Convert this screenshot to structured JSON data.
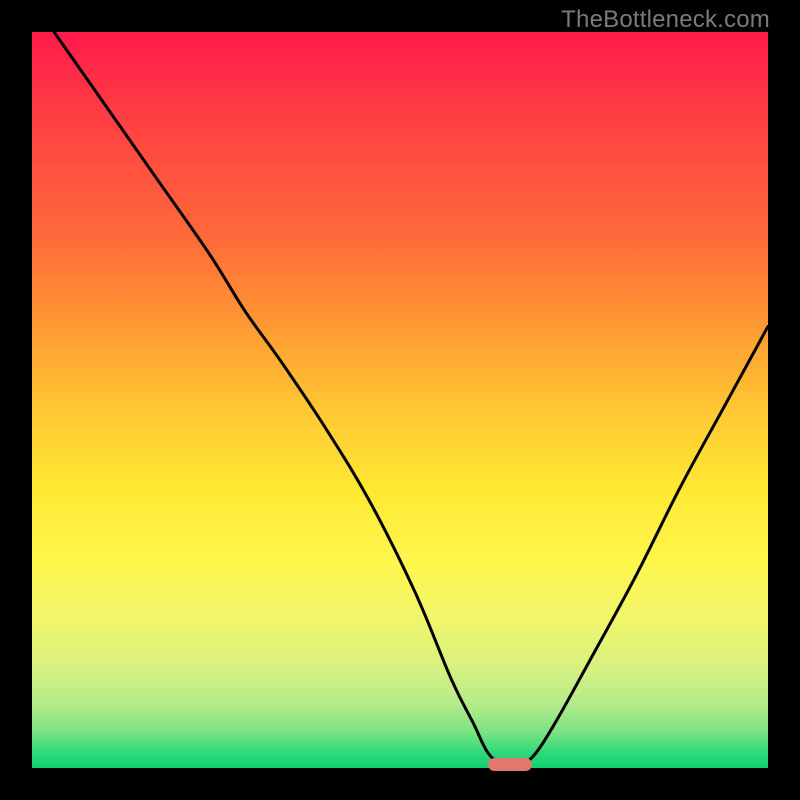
{
  "watermark": "TheBottleneck.com",
  "colors": {
    "page_bg": "#000000",
    "curve_stroke": "#000000",
    "marker_fill": "#e2786d",
    "watermark_fg": "#7a7a7a"
  },
  "chart_data": {
    "type": "line",
    "title": "",
    "xlabel": "",
    "ylabel": "",
    "xlim": [
      0,
      100
    ],
    "ylim": [
      0,
      100
    ],
    "grid": false,
    "legend": false,
    "note": "No axis ticks or labels rendered; values are read as percentages of the plot area. y=0 is the bottom (green), y=100 is the top (red). Curve descends from top-left, flattens near bottom around x≈62–67, then rises toward the right edge.",
    "series": [
      {
        "name": "bottleneck-curve",
        "x": [
          3,
          10,
          17,
          24,
          29,
          34,
          40,
          46,
          52,
          57,
          60,
          62,
          64,
          66,
          68,
          71,
          76,
          82,
          88,
          94,
          100
        ],
        "y": [
          100,
          90,
          80,
          70,
          62,
          55,
          46,
          36,
          24,
          12,
          6,
          2,
          0.5,
          0.5,
          1.5,
          6,
          15,
          26,
          38,
          49,
          60
        ]
      }
    ],
    "marker": {
      "name": "optimal-range",
      "x_start": 62,
      "x_end": 68,
      "y": 0.5
    },
    "background_gradient": [
      {
        "pos": 0,
        "color": "#ff1a4b"
      },
      {
        "pos": 28,
        "color": "#ff6a3a"
      },
      {
        "pos": 52,
        "color": "#ffc933"
      },
      {
        "pos": 72,
        "color": "#fff64d"
      },
      {
        "pos": 91,
        "color": "#b8ec8a"
      },
      {
        "pos": 100,
        "color": "#0fce70"
      }
    ]
  }
}
